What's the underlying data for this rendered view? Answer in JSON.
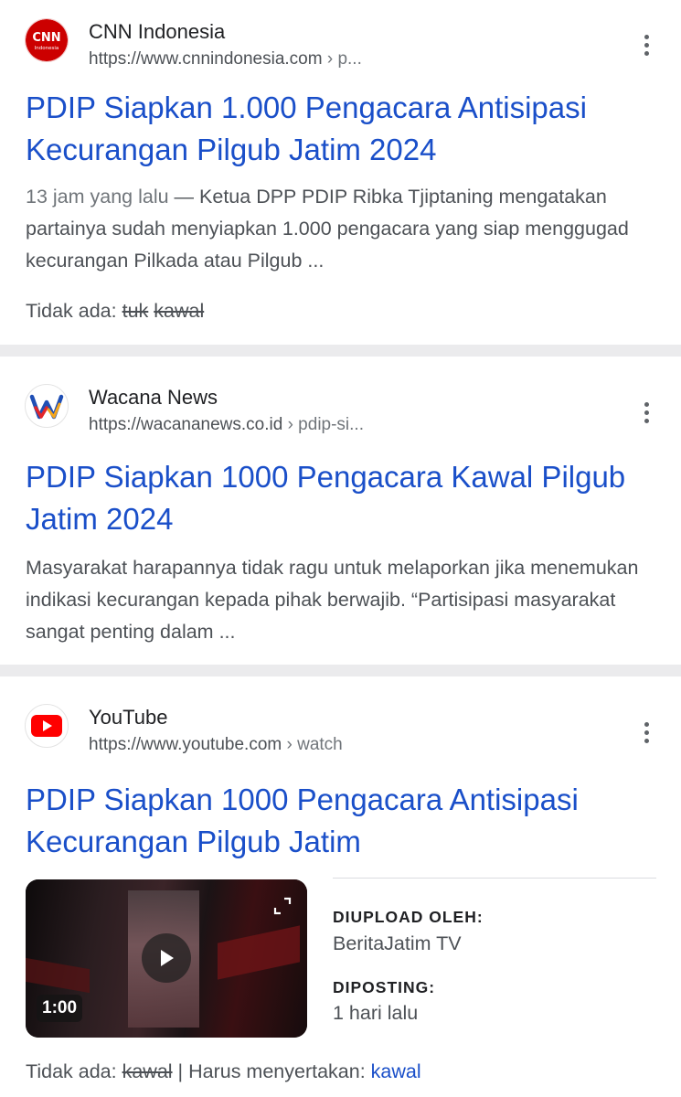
{
  "results": [
    {
      "site_name": "CNN Indonesia",
      "url": "https://www.cnnindonesia.com",
      "url_crumb": " › p...",
      "favicon": "cnn-indonesia-logo",
      "title": "PDIP Siapkan 1.000 Pengacara Antisipasi Kecurangan Pilgub Jatim 2024",
      "snippet_date": "13 jam yang lalu",
      "snippet_sep": " — ",
      "snippet": "Ketua DPP PDIP Ribka Tjiptaning mengatakan partainya sudah menyiapkan 1.000 pengacara yang siap menggugad kecurangan Pilkada atau Pilgub ...",
      "missing_label": "Tidak ada:",
      "missing_terms": [
        "tuk",
        "kawal"
      ]
    },
    {
      "site_name": "Wacana News",
      "url": "https://wacananews.co.id",
      "url_crumb": " › pdip-si...",
      "favicon": "wacana-news-logo",
      "title": "PDIP Siapkan 1000 Pengacara Kawal Pilgub Jatim 2024",
      "snippet": "Masyarakat harapannya tidak ragu untuk melaporkan jika menemukan indikasi kecurangan kepada pihak berwajib. “Partisipasi masyarakat sangat penting dalam ..."
    },
    {
      "site_name": "YouTube",
      "url": "https://www.youtube.com",
      "url_crumb": " › watch",
      "favicon": "youtube-logo",
      "title": "PDIP Siapkan 1000 Pengacara Antisipasi Kecurangan Pilgub Jatim",
      "video_duration": "1:00",
      "uploaded_by_label": "DIUPLOAD OLEH:",
      "uploaded_by": "BeritaJatim TV",
      "posted_label": "DIPOSTING:",
      "posted": "1 hari lalu",
      "missing_label": "Tidak ada:",
      "missing_term": "kawal",
      "must_include_label": " | Harus menyertakan: ",
      "must_include_term": "kawal"
    }
  ],
  "colors": {
    "link_blue": "#1a4fc9",
    "snippet_gray": "#4d5156",
    "divider_gray": "#ebebed",
    "cnn_red": "#cc0000",
    "youtube_red": "#ff0000"
  }
}
